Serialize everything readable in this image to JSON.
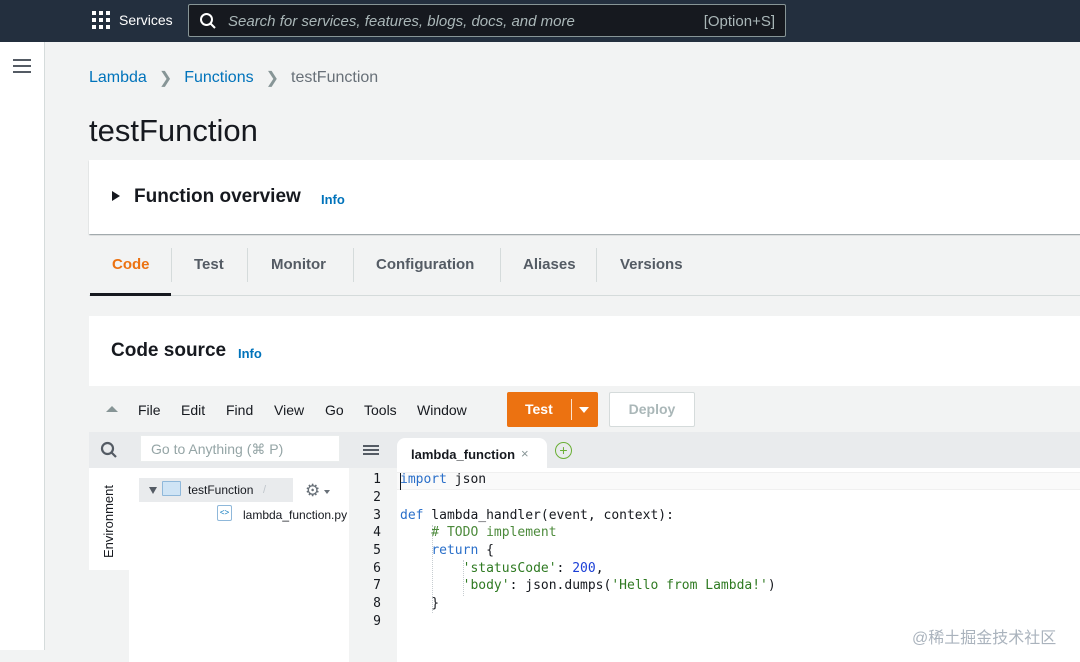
{
  "topbar": {
    "services_label": "Services",
    "search_placeholder": "Search for services, features, blogs, docs, and more",
    "search_shortcut": "[Option+S]"
  },
  "breadcrumb": [
    "Lambda",
    "Functions",
    "testFunction"
  ],
  "page_title": "testFunction",
  "overview": {
    "title": "Function overview",
    "info": "Info"
  },
  "tabs": [
    "Code",
    "Test",
    "Monitor",
    "Configuration",
    "Aliases",
    "Versions"
  ],
  "active_tab": "Code",
  "code_source": {
    "title": "Code source",
    "info": "Info"
  },
  "ide_menu": [
    "File",
    "Edit",
    "Find",
    "View",
    "Go",
    "Tools",
    "Window"
  ],
  "buttons": {
    "test": "Test",
    "deploy": "Deploy"
  },
  "goto_placeholder": "Go to Anything (⌘ P)",
  "environment_label": "Environment",
  "tree": {
    "folder": "testFunction",
    "folder_suffix": "/",
    "file": "lambda_function.py"
  },
  "editor_tab": {
    "label": "lambda_function",
    "close": "×",
    "add": "+"
  },
  "line_numbers": [
    "1",
    "2",
    "3",
    "4",
    "5",
    "6",
    "7",
    "8",
    "9"
  ],
  "code_lines": [
    "import json",
    "",
    "def lambda_handler(event, context):",
    "    # TODO implement",
    "    return {",
    "        'statusCode': 200,",
    "        'body': json.dumps('Hello from Lambda!')",
    "    }",
    ""
  ],
  "watermark": "@稀土掘金技术社区",
  "colors": {
    "accent": "#ec7211",
    "link": "#0073bb",
    "topbar": "#232f3e"
  }
}
